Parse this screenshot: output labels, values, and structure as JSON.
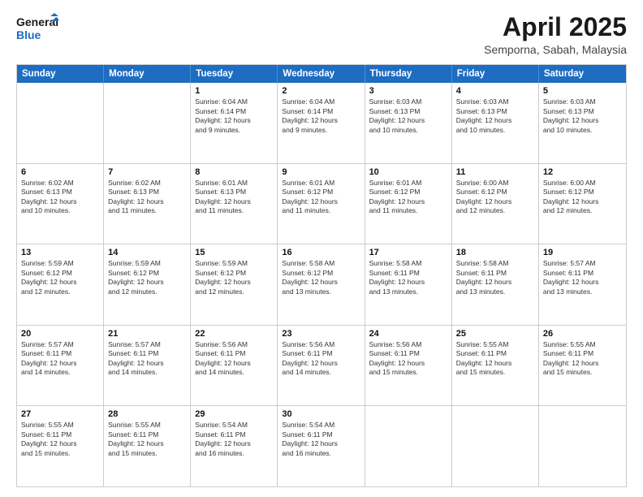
{
  "logo": {
    "line1": "General",
    "line2": "Blue"
  },
  "title": "April 2025",
  "subtitle": "Semporna, Sabah, Malaysia",
  "header_days": [
    "Sunday",
    "Monday",
    "Tuesday",
    "Wednesday",
    "Thursday",
    "Friday",
    "Saturday"
  ],
  "weeks": [
    [
      {
        "day": "",
        "lines": []
      },
      {
        "day": "",
        "lines": []
      },
      {
        "day": "1",
        "lines": [
          "Sunrise: 6:04 AM",
          "Sunset: 6:14 PM",
          "Daylight: 12 hours",
          "and 9 minutes."
        ]
      },
      {
        "day": "2",
        "lines": [
          "Sunrise: 6:04 AM",
          "Sunset: 6:14 PM",
          "Daylight: 12 hours",
          "and 9 minutes."
        ]
      },
      {
        "day": "3",
        "lines": [
          "Sunrise: 6:03 AM",
          "Sunset: 6:13 PM",
          "Daylight: 12 hours",
          "and 10 minutes."
        ]
      },
      {
        "day": "4",
        "lines": [
          "Sunrise: 6:03 AM",
          "Sunset: 6:13 PM",
          "Daylight: 12 hours",
          "and 10 minutes."
        ]
      },
      {
        "day": "5",
        "lines": [
          "Sunrise: 6:03 AM",
          "Sunset: 6:13 PM",
          "Daylight: 12 hours",
          "and 10 minutes."
        ]
      }
    ],
    [
      {
        "day": "6",
        "lines": [
          "Sunrise: 6:02 AM",
          "Sunset: 6:13 PM",
          "Daylight: 12 hours",
          "and 10 minutes."
        ]
      },
      {
        "day": "7",
        "lines": [
          "Sunrise: 6:02 AM",
          "Sunset: 6:13 PM",
          "Daylight: 12 hours",
          "and 11 minutes."
        ]
      },
      {
        "day": "8",
        "lines": [
          "Sunrise: 6:01 AM",
          "Sunset: 6:13 PM",
          "Daylight: 12 hours",
          "and 11 minutes."
        ]
      },
      {
        "day": "9",
        "lines": [
          "Sunrise: 6:01 AM",
          "Sunset: 6:12 PM",
          "Daylight: 12 hours",
          "and 11 minutes."
        ]
      },
      {
        "day": "10",
        "lines": [
          "Sunrise: 6:01 AM",
          "Sunset: 6:12 PM",
          "Daylight: 12 hours",
          "and 11 minutes."
        ]
      },
      {
        "day": "11",
        "lines": [
          "Sunrise: 6:00 AM",
          "Sunset: 6:12 PM",
          "Daylight: 12 hours",
          "and 12 minutes."
        ]
      },
      {
        "day": "12",
        "lines": [
          "Sunrise: 6:00 AM",
          "Sunset: 6:12 PM",
          "Daylight: 12 hours",
          "and 12 minutes."
        ]
      }
    ],
    [
      {
        "day": "13",
        "lines": [
          "Sunrise: 5:59 AM",
          "Sunset: 6:12 PM",
          "Daylight: 12 hours",
          "and 12 minutes."
        ]
      },
      {
        "day": "14",
        "lines": [
          "Sunrise: 5:59 AM",
          "Sunset: 6:12 PM",
          "Daylight: 12 hours",
          "and 12 minutes."
        ]
      },
      {
        "day": "15",
        "lines": [
          "Sunrise: 5:59 AM",
          "Sunset: 6:12 PM",
          "Daylight: 12 hours",
          "and 12 minutes."
        ]
      },
      {
        "day": "16",
        "lines": [
          "Sunrise: 5:58 AM",
          "Sunset: 6:12 PM",
          "Daylight: 12 hours",
          "and 13 minutes."
        ]
      },
      {
        "day": "17",
        "lines": [
          "Sunrise: 5:58 AM",
          "Sunset: 6:11 PM",
          "Daylight: 12 hours",
          "and 13 minutes."
        ]
      },
      {
        "day": "18",
        "lines": [
          "Sunrise: 5:58 AM",
          "Sunset: 6:11 PM",
          "Daylight: 12 hours",
          "and 13 minutes."
        ]
      },
      {
        "day": "19",
        "lines": [
          "Sunrise: 5:57 AM",
          "Sunset: 6:11 PM",
          "Daylight: 12 hours",
          "and 13 minutes."
        ]
      }
    ],
    [
      {
        "day": "20",
        "lines": [
          "Sunrise: 5:57 AM",
          "Sunset: 6:11 PM",
          "Daylight: 12 hours",
          "and 14 minutes."
        ]
      },
      {
        "day": "21",
        "lines": [
          "Sunrise: 5:57 AM",
          "Sunset: 6:11 PM",
          "Daylight: 12 hours",
          "and 14 minutes."
        ]
      },
      {
        "day": "22",
        "lines": [
          "Sunrise: 5:56 AM",
          "Sunset: 6:11 PM",
          "Daylight: 12 hours",
          "and 14 minutes."
        ]
      },
      {
        "day": "23",
        "lines": [
          "Sunrise: 5:56 AM",
          "Sunset: 6:11 PM",
          "Daylight: 12 hours",
          "and 14 minutes."
        ]
      },
      {
        "day": "24",
        "lines": [
          "Sunrise: 5:56 AM",
          "Sunset: 6:11 PM",
          "Daylight: 12 hours",
          "and 15 minutes."
        ]
      },
      {
        "day": "25",
        "lines": [
          "Sunrise: 5:55 AM",
          "Sunset: 6:11 PM",
          "Daylight: 12 hours",
          "and 15 minutes."
        ]
      },
      {
        "day": "26",
        "lines": [
          "Sunrise: 5:55 AM",
          "Sunset: 6:11 PM",
          "Daylight: 12 hours",
          "and 15 minutes."
        ]
      }
    ],
    [
      {
        "day": "27",
        "lines": [
          "Sunrise: 5:55 AM",
          "Sunset: 6:11 PM",
          "Daylight: 12 hours",
          "and 15 minutes."
        ]
      },
      {
        "day": "28",
        "lines": [
          "Sunrise: 5:55 AM",
          "Sunset: 6:11 PM",
          "Daylight: 12 hours",
          "and 15 minutes."
        ]
      },
      {
        "day": "29",
        "lines": [
          "Sunrise: 5:54 AM",
          "Sunset: 6:11 PM",
          "Daylight: 12 hours",
          "and 16 minutes."
        ]
      },
      {
        "day": "30",
        "lines": [
          "Sunrise: 5:54 AM",
          "Sunset: 6:11 PM",
          "Daylight: 12 hours",
          "and 16 minutes."
        ]
      },
      {
        "day": "",
        "lines": []
      },
      {
        "day": "",
        "lines": []
      },
      {
        "day": "",
        "lines": []
      }
    ]
  ]
}
